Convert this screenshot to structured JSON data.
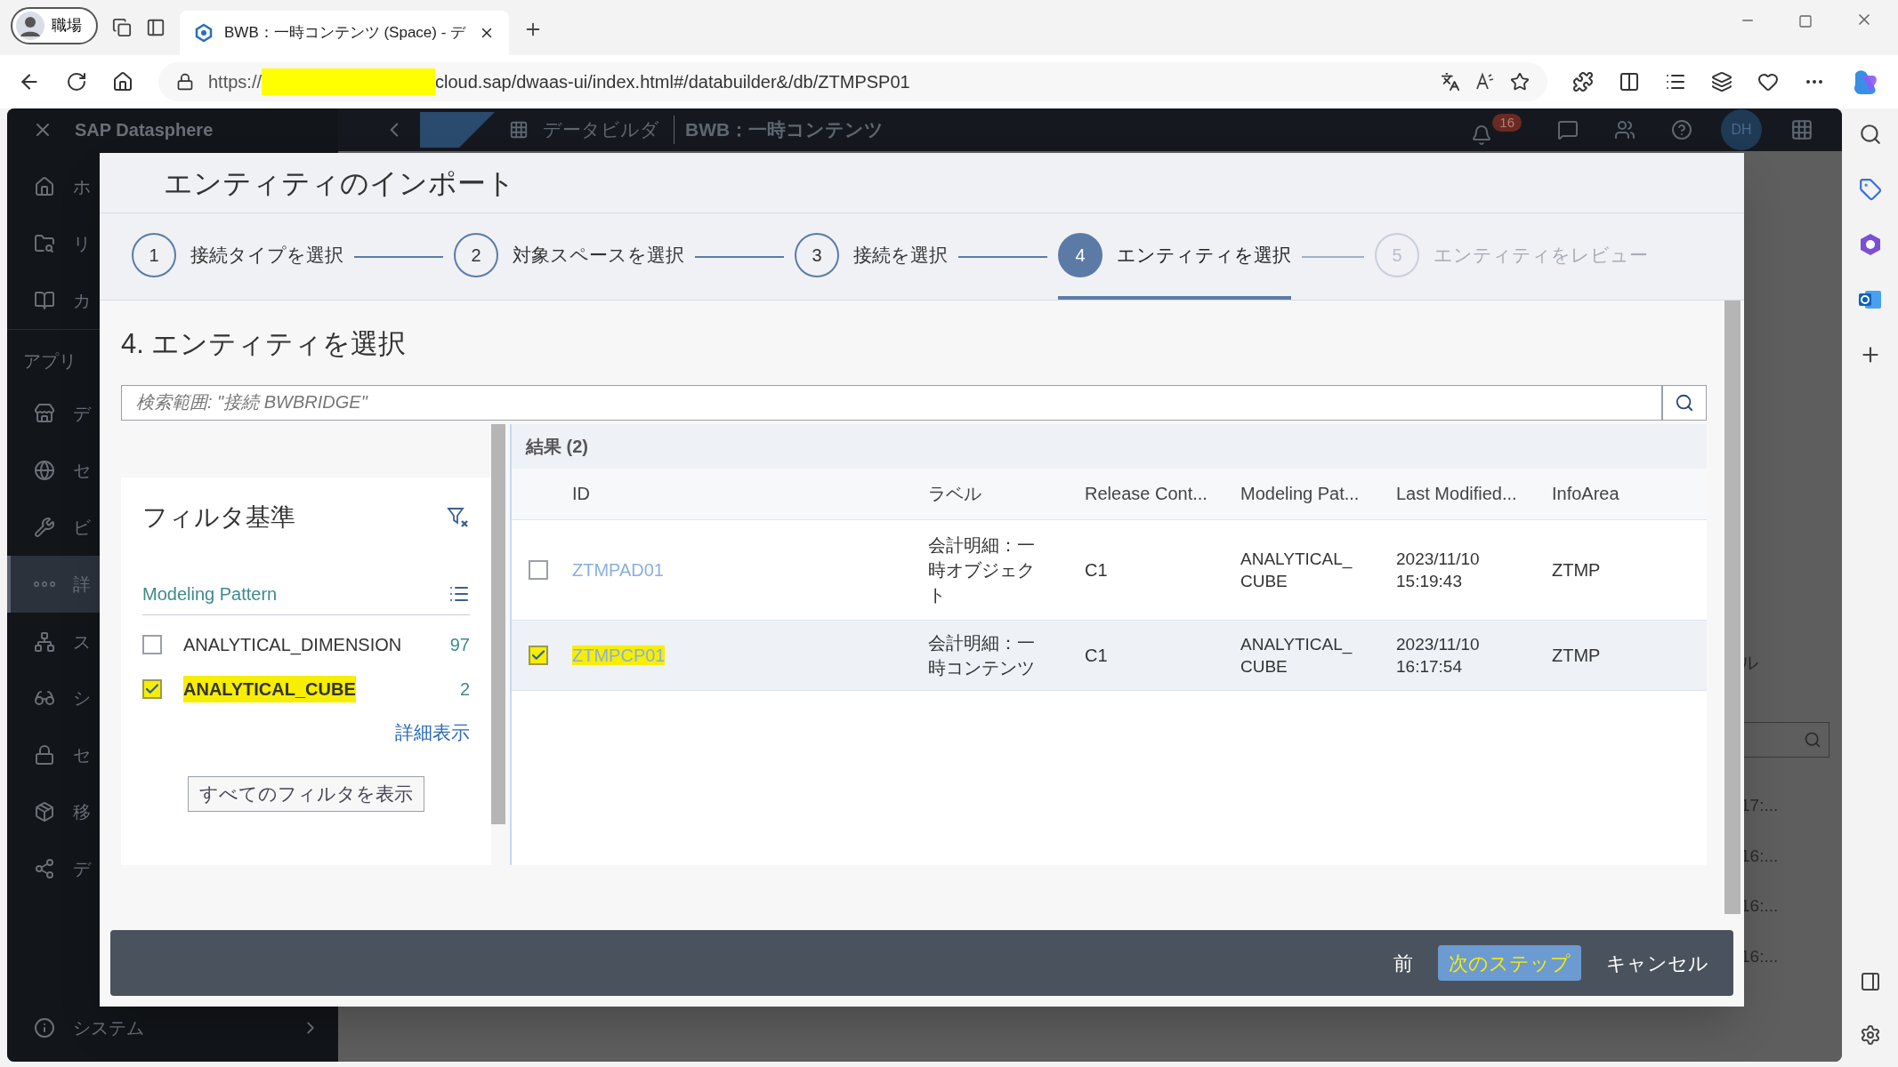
{
  "browser": {
    "profile": "職場",
    "tab_title": "BWB：一時コンテンツ (Space) - デ",
    "url_prefix": "https://",
    "url_redacted": true,
    "url_rest": "cloud.sap/dwaas-ui/index.html#/databuilder&/db/ZTMPSP01"
  },
  "app": {
    "brand": "SAP Datasphere",
    "breadcrumb": "データビルダ",
    "page_title": "BWB：一時コンテンツ",
    "notification_count": "16",
    "avatar": "DH",
    "sidebar": [
      {
        "kind": "home",
        "text": "ホ",
        "selected": false
      },
      {
        "kind": "folder-search",
        "text": "リ",
        "selected": false
      },
      {
        "kind": "book",
        "text": "カ",
        "selected": false
      },
      {
        "kind": "section",
        "text": "アプリ"
      },
      {
        "kind": "store",
        "text": "デ",
        "selected": false
      },
      {
        "kind": "globe",
        "text": "セ",
        "selected": false
      },
      {
        "kind": "wrench",
        "text": "ビ",
        "selected": false
      },
      {
        "kind": "dots",
        "text": "詳",
        "selected": true
      },
      {
        "kind": "network",
        "text": "ス",
        "selected": false
      },
      {
        "kind": "glasses",
        "text": "シ",
        "selected": false
      },
      {
        "kind": "lock",
        "text": "セ",
        "selected": false
      },
      {
        "kind": "package",
        "text": "移",
        "selected": false
      },
      {
        "kind": "share",
        "text": "デ",
        "selected": false
      },
      {
        "kind": "info",
        "text": "システム",
        "selected": false
      }
    ],
    "background_fragments": {
      "label": "ル",
      "times": [
        "17:...",
        "16:...",
        "16:...",
        "16:..."
      ]
    }
  },
  "dialog": {
    "title": "エンティティのインポート",
    "steps": [
      {
        "number": "1",
        "label": "接続タイプを選択",
        "selected": false,
        "done": true
      },
      {
        "number": "2",
        "label": "対象スペースを選択",
        "selected": false,
        "done": true
      },
      {
        "number": "3",
        "label": "接続を選択",
        "selected": false,
        "done": true
      },
      {
        "number": "4",
        "label": "エンティティを選択",
        "selected": true,
        "done": true
      },
      {
        "number": "5",
        "label": "エンティティをレビュー",
        "selected": false,
        "done": false
      }
    ],
    "section_title": "4. エンティティを選択",
    "search": {
      "placeholder": "検索範囲: \"接続 BWBRIDGE\""
    },
    "filter": {
      "title": "フィルタ基準",
      "group": "Modeling Pattern",
      "items": [
        {
          "label": "ANALYTICAL_DIMENSION",
          "count": "97",
          "checked": false,
          "highlighted": false
        },
        {
          "label": "ANALYTICAL_CUBE",
          "count": "2",
          "checked": true,
          "highlighted": true
        }
      ],
      "more_link": "詳細表示",
      "show_all_button": "すべてのフィルタを表示"
    },
    "results": {
      "heading": "結果 (2)",
      "columns": [
        "ID",
        "ラベル",
        "Release Cont...",
        "Modeling Pat...",
        "Last Modified...",
        "InfoArea"
      ],
      "rows": [
        {
          "checked": false,
          "highlighted": false,
          "id": "ZTMPAD01",
          "label": "会計明細：一時オブジェクト",
          "release": "C1",
          "modeling": "ANALYTICAL_ CUBE",
          "modified": "2023/11/10 15:19:43",
          "infoarea": "ZTMP"
        },
        {
          "checked": true,
          "highlighted": true,
          "id": "ZTMPCP01",
          "label": "会計明細：一時コンテンツ",
          "release": "C1",
          "modeling": "ANALYTICAL_ CUBE",
          "modified": "2023/11/10 16:17:54",
          "infoarea": "ZTMP"
        }
      ]
    },
    "footer": [
      {
        "label": "前",
        "kind": "plain",
        "highlighted": false
      },
      {
        "label": "次のステップ",
        "kind": "primary",
        "highlighted": true
      },
      {
        "label": "キャンセル",
        "kind": "plain",
        "highlighted": false
      }
    ]
  }
}
